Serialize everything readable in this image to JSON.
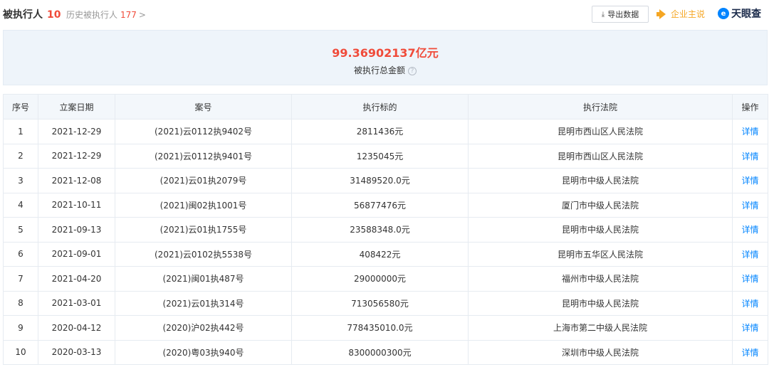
{
  "header": {
    "title": "被执行人",
    "count": "10",
    "history_label": "历史被执行人",
    "history_count": "177",
    "history_chevron": ">",
    "export_label": "导出数据",
    "enterprise_say_label": "企业主说",
    "brand_name": "天眼查",
    "icons": {
      "export": "download-icon",
      "enterprise_say": "speaker-icon",
      "brand": "tianyancha-logo"
    }
  },
  "summary": {
    "amount": "99.36902137亿元",
    "label": "被执行总金额",
    "help": "?"
  },
  "table": {
    "headers": [
      "序号",
      "立案日期",
      "案号",
      "执行标的",
      "执行法院",
      "操作"
    ],
    "rows": [
      {
        "index": "1",
        "date": "2021-12-29",
        "case_no": "(2021)云0112执9402号",
        "amount": "2811436元",
        "court": "昆明市西山区人民法院",
        "action": "详情"
      },
      {
        "index": "2",
        "date": "2021-12-29",
        "case_no": "(2021)云0112执9401号",
        "amount": "1235045元",
        "court": "昆明市西山区人民法院",
        "action": "详情"
      },
      {
        "index": "3",
        "date": "2021-12-08",
        "case_no": "(2021)云01执2079号",
        "amount": "31489520.0元",
        "court": "昆明市中级人民法院",
        "action": "详情"
      },
      {
        "index": "4",
        "date": "2021-10-11",
        "case_no": "(2021)闽02执1001号",
        "amount": "56877476元",
        "court": "厦门市中级人民法院",
        "action": "详情"
      },
      {
        "index": "5",
        "date": "2021-09-13",
        "case_no": "(2021)云01执1755号",
        "amount": "23588348.0元",
        "court": "昆明市中级人民法院",
        "action": "详情"
      },
      {
        "index": "6",
        "date": "2021-09-01",
        "case_no": "(2021)云0102执5538号",
        "amount": "408422元",
        "court": "昆明市五华区人民法院",
        "action": "详情"
      },
      {
        "index": "7",
        "date": "2021-04-20",
        "case_no": "(2021)闽01执487号",
        "amount": "29000000元",
        "court": "福州市中级人民法院",
        "action": "详情"
      },
      {
        "index": "8",
        "date": "2021-03-01",
        "case_no": "(2021)云01执314号",
        "amount": "713056580元",
        "court": "昆明市中级人民法院",
        "action": "详情"
      },
      {
        "index": "9",
        "date": "2020-04-12",
        "case_no": "(2020)沪02执442号",
        "amount": "778435010.0元",
        "court": "上海市第二中级人民法院",
        "action": "详情"
      },
      {
        "index": "10",
        "date": "2020-03-13",
        "case_no": "(2020)粤03执940号",
        "amount": "8300000300元",
        "court": "深圳市中级人民法院",
        "action": "详情"
      }
    ]
  },
  "colors": {
    "accent_red": "#f04b3a",
    "link_blue": "#0084ff",
    "orange": "#f5a623",
    "summary_bg": "#eef4fa",
    "header_bg": "#f3f7fb"
  }
}
